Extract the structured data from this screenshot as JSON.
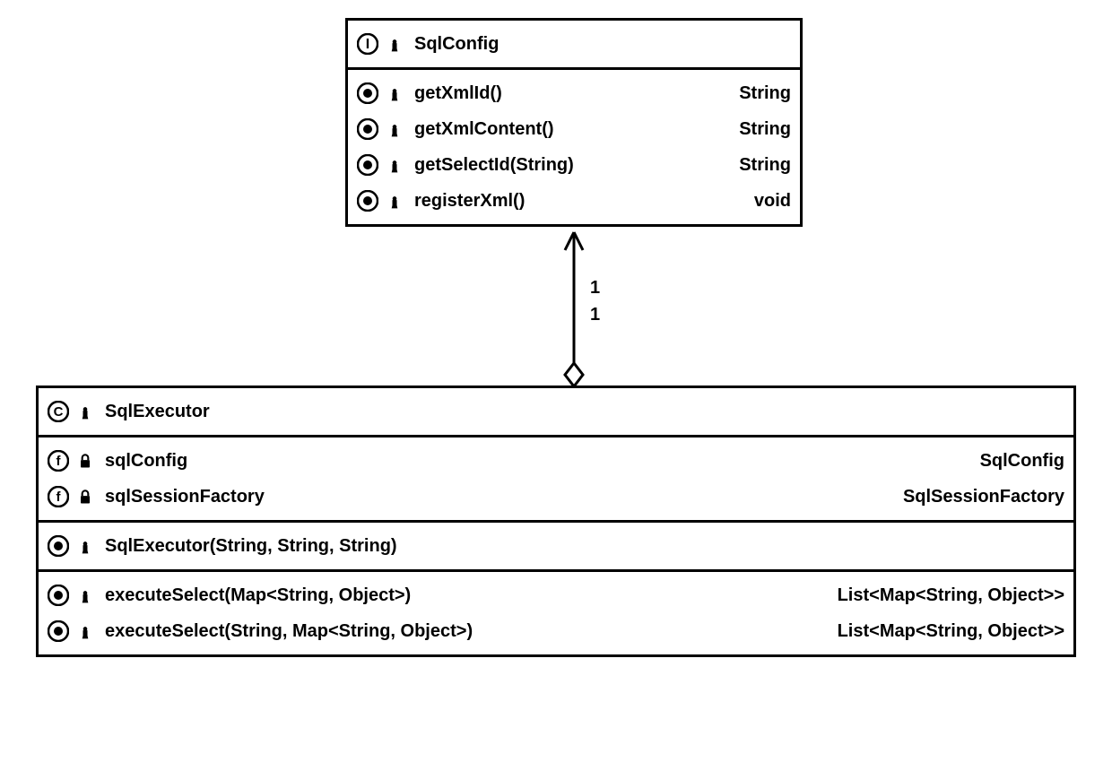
{
  "classes": {
    "sqlConfig": {
      "name": "SqlConfig",
      "typeIcon": "interface-icon",
      "visibility": "package",
      "members": [
        {
          "icon": "method-icon",
          "vis": "package",
          "sig": "getXmlId()",
          "ret": "String"
        },
        {
          "icon": "method-icon",
          "vis": "package",
          "sig": "getXmlContent()",
          "ret": "String"
        },
        {
          "icon": "method-icon",
          "vis": "package",
          "sig": "getSelectId(String)",
          "ret": "String"
        },
        {
          "icon": "method-icon",
          "vis": "package",
          "sig": "registerXml()",
          "ret": "void"
        }
      ]
    },
    "sqlExecutor": {
      "name": "SqlExecutor",
      "typeIcon": "class-icon",
      "visibility": "package",
      "fields": [
        {
          "icon": "field-icon",
          "vis": "private",
          "sig": "sqlConfig",
          "ret": "SqlConfig"
        },
        {
          "icon": "field-icon",
          "vis": "private",
          "sig": "sqlSessionFactory",
          "ret": "SqlSessionFactory"
        }
      ],
      "ctors": [
        {
          "icon": "method-icon",
          "vis": "package",
          "sig": "SqlExecutor(String, String, String)",
          "ret": ""
        }
      ],
      "methods": [
        {
          "icon": "method-icon",
          "vis": "package",
          "sig": "executeSelect(Map<String, Object>)",
          "ret": "List<Map<String, Object>>"
        },
        {
          "icon": "method-icon",
          "vis": "package",
          "sig": "executeSelect(String, Map<String, Object>)",
          "ret": "List<Map<String, Object>>"
        }
      ]
    }
  },
  "association": {
    "topMultiplicity": "1",
    "bottomMultiplicity": "1"
  }
}
